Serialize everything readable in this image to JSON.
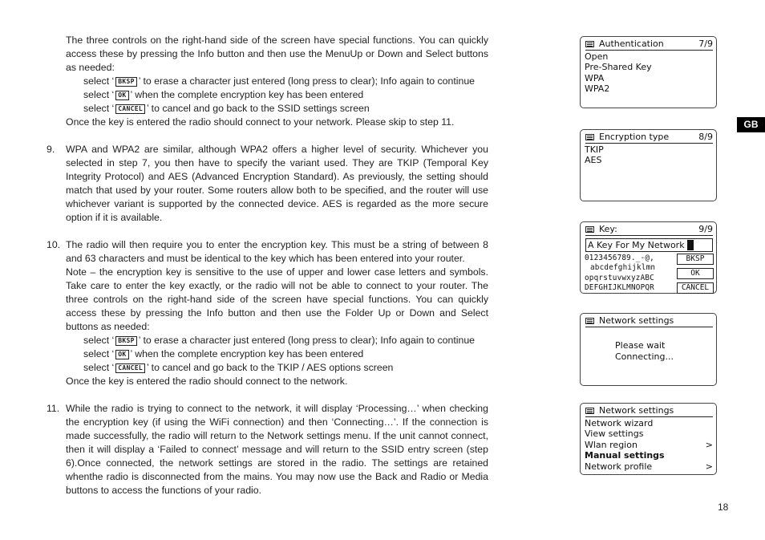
{
  "intro": {
    "paragraph": "The three controls on the right-hand side of the screen have special functions. You can quickly access these by pressing the Info button and then use the MenuUp or Down and Select buttons as needed:",
    "lines": [
      {
        "prefix": "select ‘",
        "button": "BKSP",
        "suffix": "’ to erase a character just entered (long press to clear); Info again to continue"
      },
      {
        "prefix": "select ‘",
        "button": "OK",
        "suffix": "’ when the complete encryption key has been entered"
      },
      {
        "prefix": "select ‘",
        "button": "CANCEL",
        "suffix": "’ to cancel and go back to the SSID settings screen"
      }
    ],
    "closing": "Once the key is entered the radio should connect to your network. Please skip to step 11."
  },
  "steps": [
    {
      "number": "9.",
      "text": "WPA and WPA2 are similar, although WPA2 offers a higher level of security. Whichever you selected in step 7, you then have to specify the variant used. They are TKIP (Temporal Key Integrity Protocol) and AES (Advanced Encryption Standard). As previously, the setting should match that used by your router. Some routers allow both to be specified, and the router will use whichever variant is supported by the connected device. AES is regarded as the more secure option if it is available."
    },
    {
      "number": "10.",
      "text": "The radio will then require you to enter the encryption key. This must be a string of between 8 and 63 characters and must be identical to the key which has been entered into your router.",
      "note": "Note – the encryption key is sensitive to the use of upper and lower case letters and symbols. Take care to enter the key exactly, or the radio will not be able to connect to your router. The three controls on the right-hand side of the screen have special functions. You can quickly access these by pressing the Info button and then use the Folder Up or Down and Select buttons as needed:",
      "lines": [
        {
          "prefix": "select ‘",
          "button": "BKSP",
          "suffix": "’ to erase a character just entered (long press to clear); Info again to continue"
        },
        {
          "prefix": "select ‘",
          "button": "OK",
          "suffix": "’ when the complete encryption key has been entered"
        },
        {
          "prefix": "select ‘",
          "button": "CANCEL",
          "suffix": "’ to cancel and go back to the TKIP / AES options screen"
        }
      ],
      "closing": "Once the key is entered the radio should connect to the network."
    },
    {
      "number": "11.",
      "text": "While the radio is trying to connect to the network, it will display ‘Processing…’ when checking the encryption key (if using the WiFi connection) and then ‘Connecting…’. If the connection is made successfully, the radio will return to the Network settings menu. If the unit cannot connect, then it will display a ‘Failed to connect’ message and will return to the SSID entry screen (step 6).Once connected, the network settings are stored in the radio. The settings are retained whenthe radio is disconnected from the mains. You may now use the Back and Radio or Media buttons to access the functions of your radio."
    }
  ],
  "screens": {
    "authentication": {
      "title": "Authentication",
      "count": "7/9",
      "items": [
        "Open",
        "Pre-Shared Key",
        "WPA",
        "WPA2"
      ]
    },
    "encryption": {
      "title": "Encryption type",
      "count": "8/9",
      "items": [
        "TKIP",
        "AES"
      ]
    },
    "key": {
      "title": "Key:",
      "count": "9/9",
      "value": "A Key For My Network",
      "keyboard_rows": [
        "0123456789._-@,",
        "abcdefghijklmn",
        "opqrstuvwxyzABC",
        "DEFGHIJKLMNOPQR"
      ],
      "buttons": [
        "BKSP",
        "OK",
        "CANCEL"
      ]
    },
    "connecting": {
      "title": "Network settings",
      "line1": "Please wait",
      "line2": "Connecting..."
    },
    "network_settings": {
      "title": "Network settings",
      "items": [
        {
          "label": "Network wizard",
          "arrow": ""
        },
        {
          "label": "View settings",
          "arrow": ""
        },
        {
          "label": "Wlan region",
          "arrow": ">"
        },
        {
          "label": "Manual settings",
          "arrow": ""
        },
        {
          "label": "Network profile",
          "arrow": ">"
        }
      ],
      "selected": "Manual settings"
    }
  },
  "badge": "GB",
  "page_number": "18"
}
